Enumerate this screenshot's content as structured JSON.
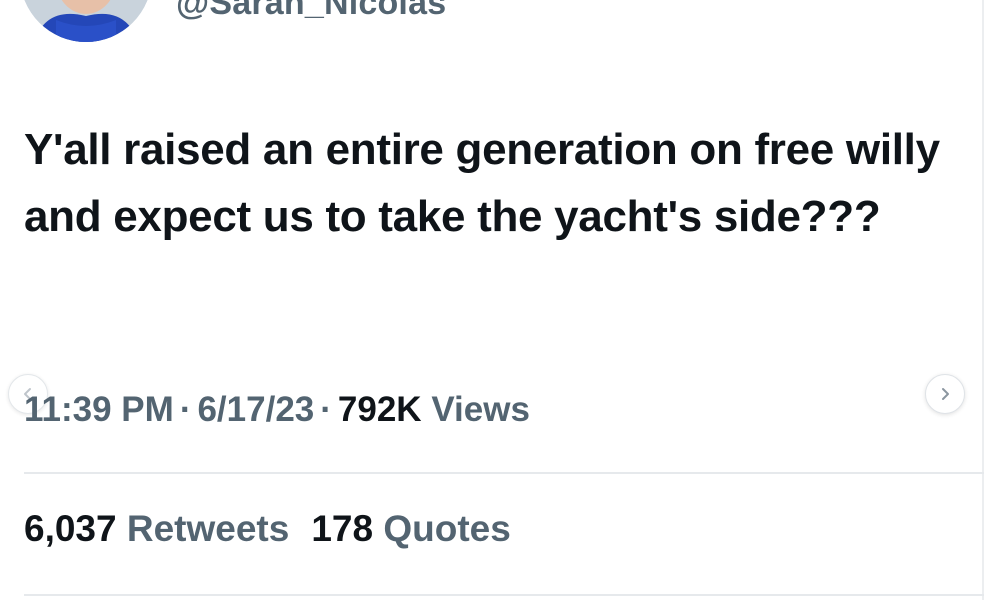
{
  "author": {
    "handle": "@Sarah_Nicolas"
  },
  "tweet": {
    "text": "Y'all raised an entire generation on free willy and expect us to take the yacht's side???"
  },
  "meta": {
    "time": "11:39 PM",
    "separator": "·",
    "date": "6/17/23",
    "views_count": "792K",
    "views_label": "Views"
  },
  "stats": {
    "retweets_count": "6,037",
    "retweets_label": "Retweets",
    "quotes_count": "178",
    "quotes_label": "Quotes"
  },
  "carousel": {
    "prev_icon": "chevron-left-icon",
    "next_icon": "chevron-right-icon"
  },
  "colors": {
    "text_primary": "#0f1419",
    "text_secondary": "#536471",
    "divider": "#e6e9ec"
  }
}
